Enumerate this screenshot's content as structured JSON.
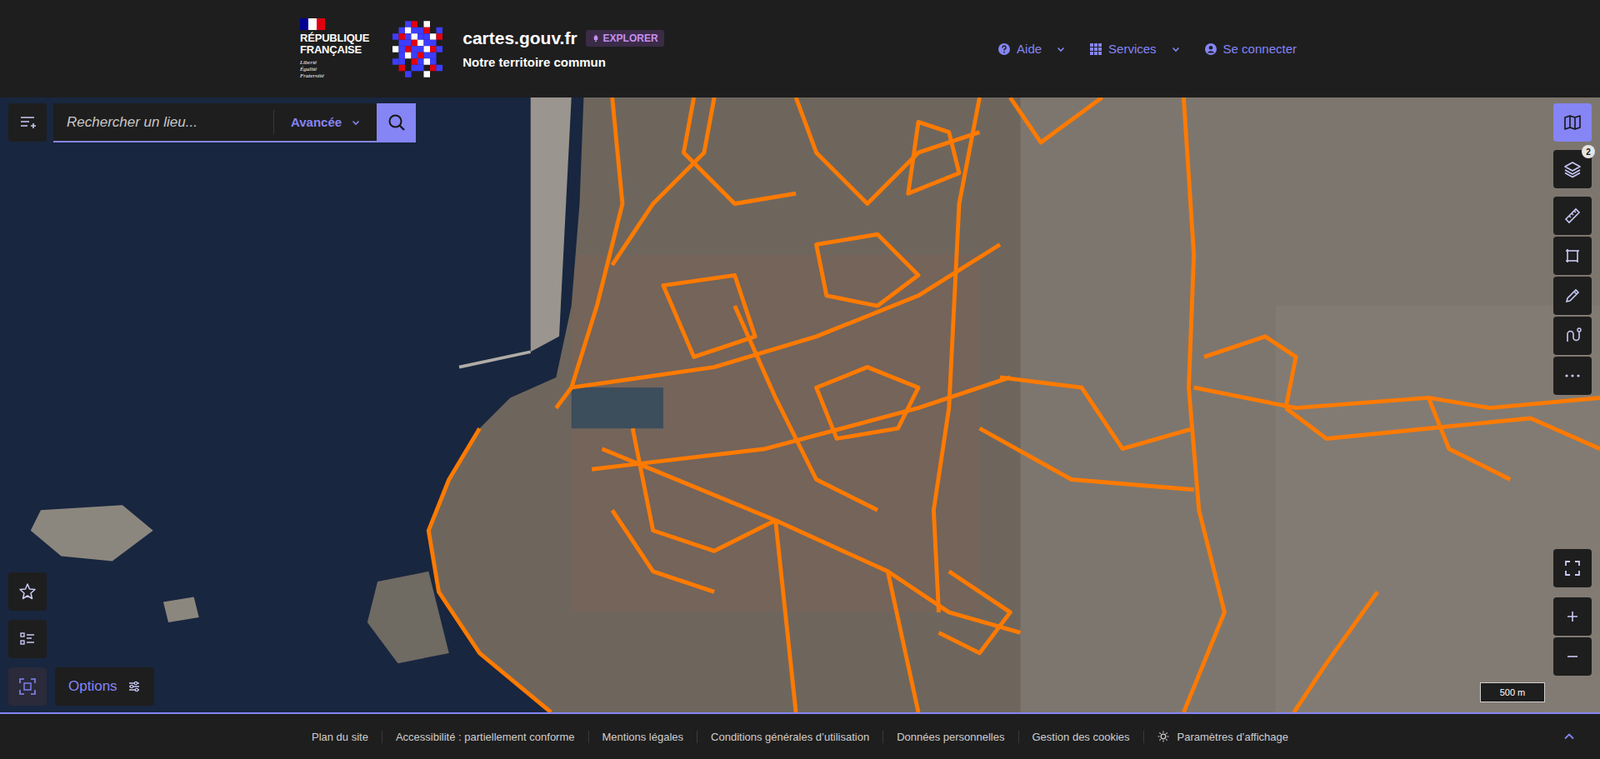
{
  "header": {
    "republic_lines": [
      "RÉPUBLIQUE",
      "FRANÇAISE"
    ],
    "motto": [
      "Liberté",
      "Égalité",
      "Fraternité"
    ],
    "site": "cartes.gouv.fr",
    "badge": "EXPLORER",
    "tagline": "Notre territoire commun",
    "nav": [
      {
        "label": "Aide",
        "dropdown": true
      },
      {
        "label": "Services",
        "dropdown": true
      },
      {
        "label": "Se connecter",
        "dropdown": false
      }
    ]
  },
  "search": {
    "placeholder": "Rechercher un lieu...",
    "mode": "Avancée"
  },
  "toolbar": {
    "basemap_selected": true,
    "layers_count": "2",
    "tools": [
      {
        "selected": false
      },
      {
        "selected": false
      },
      {
        "selected": false
      },
      {
        "selected": false
      },
      {
        "selected": false
      }
    ]
  },
  "left_controls": [
    {
      "selected": false
    },
    {
      "selected": false
    },
    {
      "selected": true
    }
  ],
  "options": "Options",
  "scale": "500 m",
  "footer": {
    "links": [
      "Plan du site",
      "Accessibilité : partiellement conforme",
      "Mentions légales",
      "Conditions générales d’utilisation",
      "Données personnelles",
      "Gestion des cookies"
    ],
    "display_settings": "Paramètres d’affichage"
  }
}
